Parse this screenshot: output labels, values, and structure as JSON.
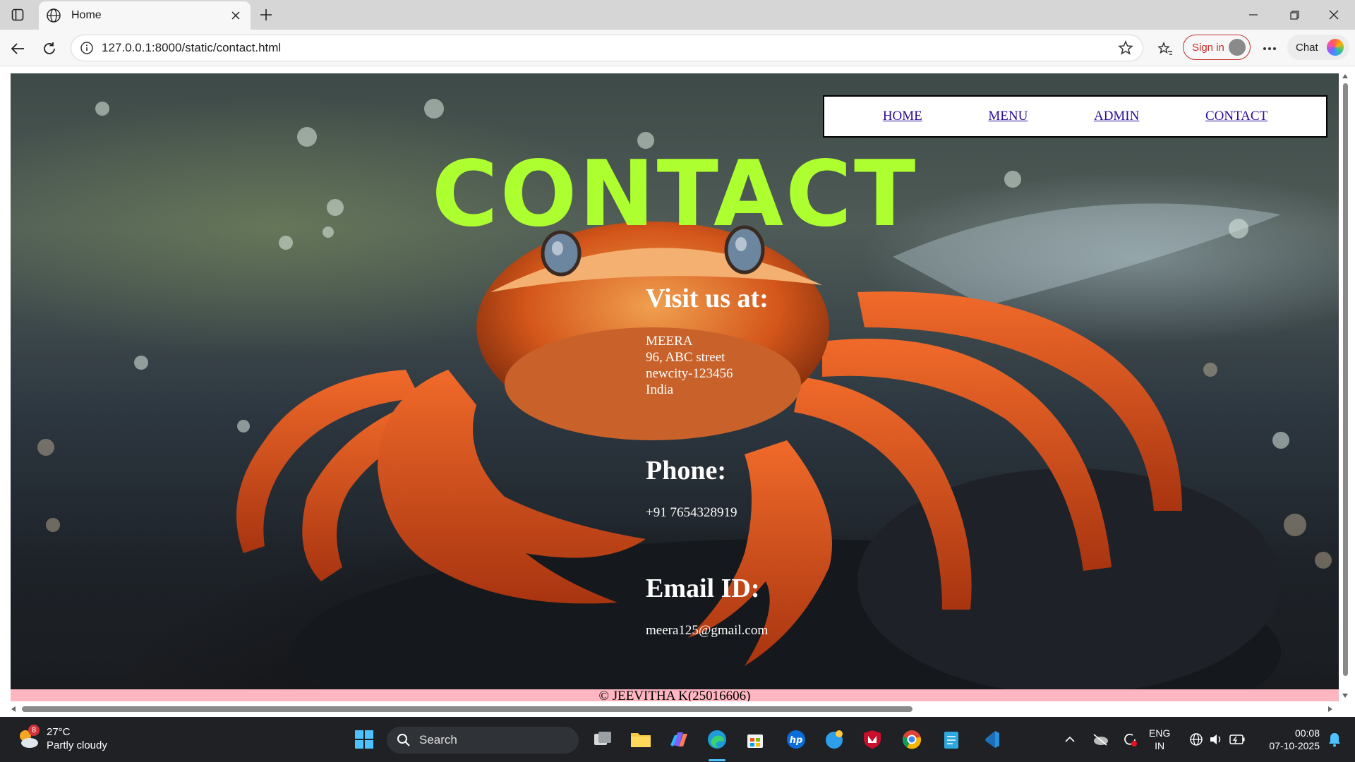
{
  "browser": {
    "tab_title": "Home",
    "url": "127.0.0.1:8000/static/contact.html",
    "signin_label": "Sign in",
    "chat_label": "Chat"
  },
  "nav": {
    "items": [
      {
        "label": "HOME"
      },
      {
        "label": "MENU"
      },
      {
        "label": "ADMIN"
      },
      {
        "label": "CONTACT"
      }
    ]
  },
  "page": {
    "title": "CONTACT",
    "visit": {
      "heading": "Visit us at:",
      "lines": [
        "MEERA",
        "96, ABC street",
        "newcity-123456",
        "India"
      ]
    },
    "phone": {
      "heading": "Phone:",
      "value": "+91 7654328919"
    },
    "email": {
      "heading": "Email ID:",
      "value": "meera125@gmail.com"
    },
    "footer": "© JEEVITHA K(25016606)",
    "title_color": "#adff2f",
    "footer_bg": "#ffb6c1"
  },
  "taskbar": {
    "weather_temp": "27°C",
    "weather_desc": "Partly cloudy",
    "weather_badge": "8",
    "search_label": "Search",
    "lang_line1": "ENG",
    "lang_line2": "IN",
    "time": "00:08",
    "date": "07-10-2025"
  }
}
